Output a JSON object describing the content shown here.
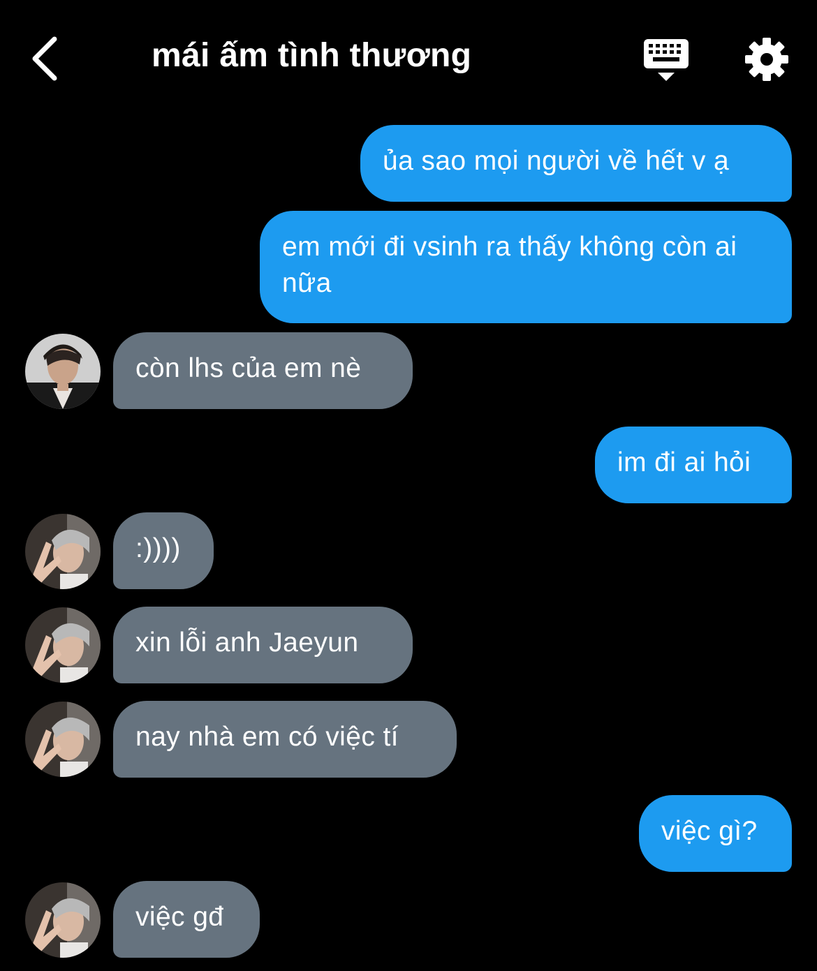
{
  "header": {
    "title": "mái ấm tình thương",
    "back_icon": "chevron-left-icon",
    "keyboard_icon": "keyboard-icon",
    "settings_icon": "gear-icon"
  },
  "colors": {
    "background": "#000000",
    "outgoing_bubble": "#1d9bf0",
    "incoming_bubble": "#66737f",
    "text": "#ffffff"
  },
  "messages": [
    {
      "direction": "out",
      "text": "ủa sao mọi người về hết v ạ"
    },
    {
      "direction": "out",
      "text": "em mới đi vsinh ra thấy không còn ai nữa"
    },
    {
      "direction": "in",
      "avatar": "avatar-user-1",
      "text": "còn lhs của em nè"
    },
    {
      "direction": "out",
      "text": "im đi ai hỏi"
    },
    {
      "direction": "in",
      "avatar": "avatar-user-2",
      "text": ":))))"
    },
    {
      "direction": "in",
      "avatar": "avatar-user-2",
      "text": "xin lỗi anh Jaeyun"
    },
    {
      "direction": "in",
      "avatar": "avatar-user-2",
      "text": "nay nhà em có việc tí"
    },
    {
      "direction": "out",
      "text": "việc gì?"
    },
    {
      "direction": "in",
      "avatar": "avatar-user-2",
      "text": "việc gđ"
    }
  ]
}
